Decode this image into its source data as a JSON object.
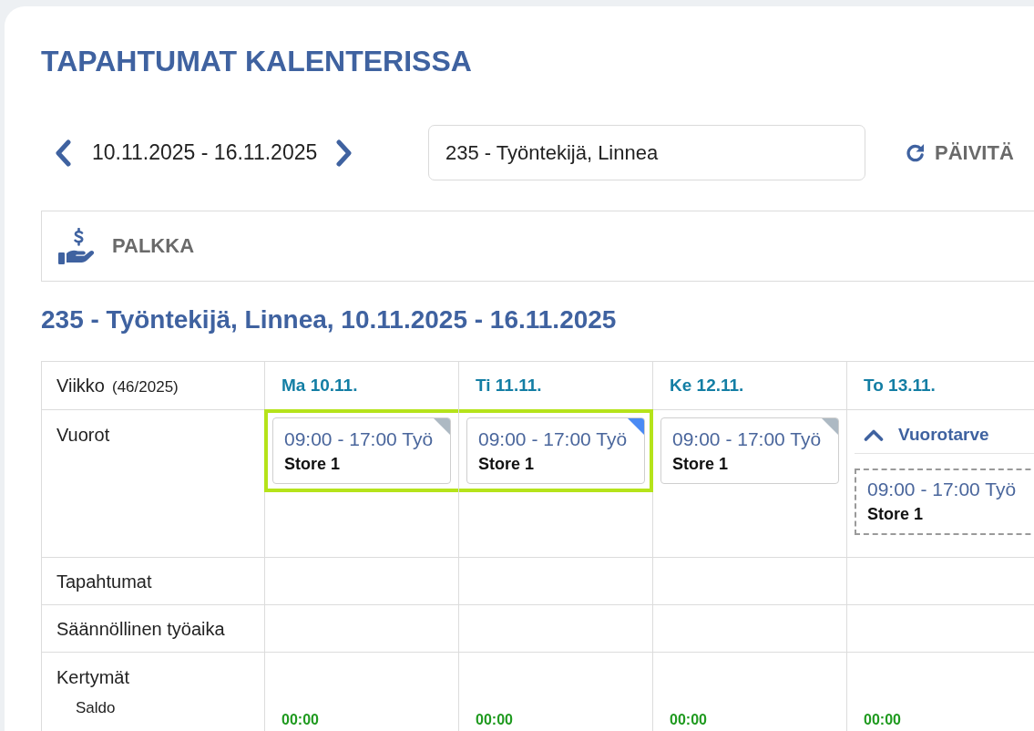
{
  "page_title": "TAPAHTUMAT KALENTERISSA",
  "toolbar": {
    "date_range": "10.11.2025 - 16.11.2025",
    "employee_select": {
      "value": "235 - Työntekijä, Linnea"
    },
    "refresh_button": "PÄIVITÄ"
  },
  "panel": {
    "label": "PALKKA"
  },
  "heading": "235 - Työntekijä, Linnea, 10.11.2025 - 16.11.2025",
  "table": {
    "week_label": "Viikko",
    "week_number": "(46/2025)",
    "row_labels": {
      "shifts": "Vuorot",
      "events": "Tapahtumat",
      "regular_hours": "Säännöllinen työaika",
      "accruals": "Kertymät",
      "balance": "Saldo"
    },
    "days": [
      {
        "label": "Ma 10.11.",
        "shifts": [
          {
            "time": "09:00 - 17:00 Työ",
            "location": "Store 1",
            "color": "#adb9c3",
            "selected": true
          }
        ],
        "balance": "00:00"
      },
      {
        "label": "Ti 11.11.",
        "shifts": [
          {
            "time": "09:00 - 17:00 Työ",
            "location": "Store 1",
            "color": "#4a8af4",
            "selected": true
          }
        ],
        "balance": "00:00"
      },
      {
        "label": "Ke 12.11.",
        "shifts": [
          {
            "time": "09:00 - 17:00 Työ",
            "location": "Store 1",
            "color": "#adb9c3",
            "selected": false
          }
        ],
        "balance": "00:00"
      },
      {
        "label": "To 13.11.",
        "demand": {
          "label": "Vuorotarve",
          "expanded": true,
          "shifts": [
            {
              "time": "09:00 - 17:00 Työ",
              "location": "Store 1"
            }
          ]
        },
        "balance": "00:00"
      }
    ]
  }
}
